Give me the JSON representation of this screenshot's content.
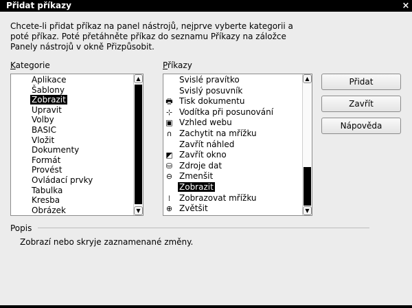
{
  "window": {
    "title": "Přidat příkazy",
    "close_glyph": "×"
  },
  "intro_text": "Chcete-li přidat příkaz na panel nástrojů, nejprve vyberte kategorii a poté příkaz. Poté přetáhněte příkaz do seznamu Příkazy na záložce Panely nástrojů v okně Přizpůsobit.",
  "categories": {
    "label_mnemonic": "K",
    "label_rest": "ategorie",
    "items": [
      {
        "label": "Aplikace",
        "selected": false
      },
      {
        "label": "Šablony",
        "selected": false
      },
      {
        "label": "Zobrazit",
        "selected": true
      },
      {
        "label": "Upravit",
        "selected": false
      },
      {
        "label": "Volby",
        "selected": false
      },
      {
        "label": "BASIC",
        "selected": false
      },
      {
        "label": "Vložit",
        "selected": false
      },
      {
        "label": "Dokumenty",
        "selected": false
      },
      {
        "label": "Formát",
        "selected": false
      },
      {
        "label": "Provést",
        "selected": false
      },
      {
        "label": "Ovládací prvky",
        "selected": false
      },
      {
        "label": "Tabulka",
        "selected": false
      },
      {
        "label": "Kresba",
        "selected": false
      },
      {
        "label": "Obrázek",
        "selected": false
      }
    ]
  },
  "commands": {
    "label_mnemonic": "P",
    "label_rest": "říkazy",
    "items": [
      {
        "label": "Svislé pravítko",
        "icon": "",
        "selected": false
      },
      {
        "label": "Svislý posuvník",
        "icon": "",
        "selected": false
      },
      {
        "label": "Tisk dokumentu",
        "icon": "print-icon",
        "selected": false
      },
      {
        "label": "Vodítka při posunování",
        "icon": "guides-icon",
        "selected": false
      },
      {
        "label": "Vzhled webu",
        "icon": "web-layout-icon",
        "selected": false
      },
      {
        "label": "Zachytit na mřížku",
        "icon": "magnet-icon",
        "selected": false
      },
      {
        "label": "Zavřít náhled",
        "icon": "",
        "selected": false
      },
      {
        "label": "Zavřít okno",
        "icon": "close-window-icon",
        "selected": false
      },
      {
        "label": "Zdroje dat",
        "icon": "data-sources-icon",
        "selected": false
      },
      {
        "label": "Zmenšit",
        "icon": "zoom-out-icon",
        "selected": false
      },
      {
        "label": "Zobrazit",
        "icon": "",
        "selected": true
      },
      {
        "label": "Zobrazovat mřížku",
        "icon": "grid-icon",
        "selected": false
      },
      {
        "label": "Zvětšit",
        "icon": "zoom-in-icon",
        "selected": false
      }
    ]
  },
  "buttons": {
    "add": "Přidat",
    "close": "Zavřít",
    "help": "Nápověda"
  },
  "description": {
    "label": "Popis",
    "text": "Zobrazí nebo skryje zaznamenané změny."
  },
  "scroll": {
    "categories_position": 0.0,
    "commands_position": 1.0
  },
  "colors": {
    "selection": "#000000",
    "titlebar": "#000000",
    "background": "#ececec"
  }
}
